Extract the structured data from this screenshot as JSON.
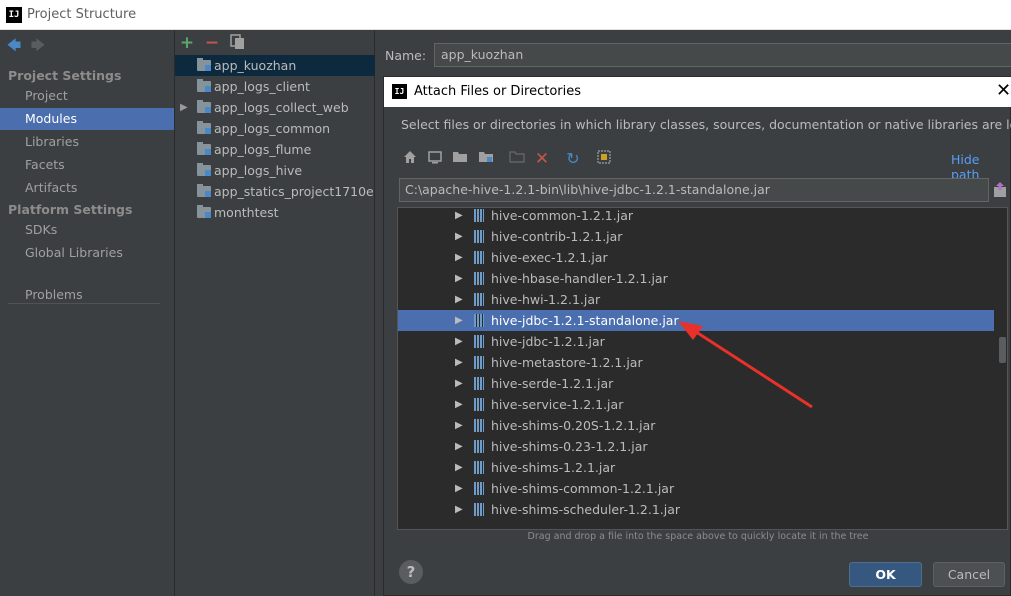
{
  "window": {
    "title": "Project Structure",
    "logo": "IJ"
  },
  "left_nav": {
    "back_icon": "back-arrow-icon",
    "forward_icon": "forward-arrow-icon",
    "project_settings_header": "Project Settings",
    "project_items": [
      "Project",
      "Modules",
      "Libraries",
      "Facets",
      "Artifacts"
    ],
    "platform_settings_header": "Platform Settings",
    "platform_items": [
      "SDKs",
      "Global Libraries"
    ],
    "problems": "Problems",
    "selected": "Modules"
  },
  "modules": {
    "toolbar": {
      "add": "+",
      "remove": "−",
      "copy": "copy-icon"
    },
    "items": [
      "app_kuozhan",
      "app_logs_client",
      "app_logs_collect_web",
      "app_logs_common",
      "app_logs_flume",
      "app_logs_hive",
      "app_statics_project1710e",
      "monthtest"
    ],
    "selected": "app_kuozhan"
  },
  "name_field": {
    "label": "Name:",
    "value": "app_kuozhan"
  },
  "dialog": {
    "title": "Attach Files or Directories",
    "logo": "IJ",
    "close": "✕",
    "description": "Select files or directories in which library classes, sources, documentation or native libraries are located",
    "hide_path": "Hide path",
    "path": "C:\\apache-hive-1.2.1-bin\\lib\\hive-jdbc-1.2.1-standalone.jar",
    "tree_items": [
      "hive-common-1.2.1.jar",
      "hive-contrib-1.2.1.jar",
      "hive-exec-1.2.1.jar",
      "hive-hbase-handler-1.2.1.jar",
      "hive-hwi-1.2.1.jar",
      "hive-jdbc-1.2.1-standalone.jar",
      "hive-jdbc-1.2.1.jar",
      "hive-metastore-1.2.1.jar",
      "hive-serde-1.2.1.jar",
      "hive-service-1.2.1.jar",
      "hive-shims-0.20S-1.2.1.jar",
      "hive-shims-0.23-1.2.1.jar",
      "hive-shims-1.2.1.jar",
      "hive-shims-common-1.2.1.jar",
      "hive-shims-scheduler-1.2.1.jar"
    ],
    "selected_item": "hive-jdbc-1.2.1-standalone.jar",
    "drag_hint": "Drag and drop a file into the space above to quickly locate it in the tree",
    "help": "?",
    "ok": "OK",
    "cancel": "Cancel",
    "annotation_color": "#e8312b"
  }
}
